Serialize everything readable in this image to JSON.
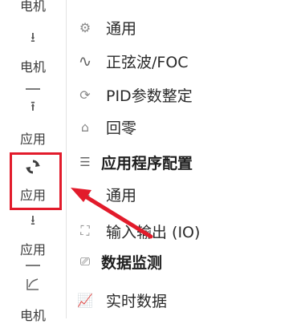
{
  "sidebar": {
    "items": [
      {
        "label": "电机",
        "icon": "download-arrow-icon"
      },
      {
        "label": "电机",
        "icon": "download-arrow-icon"
      },
      {
        "label": "应用",
        "icon": "upload-arrow-icon"
      },
      {
        "label": "应用",
        "icon": "refresh-icon"
      },
      {
        "label": "应用",
        "icon": "download-arrow-icon"
      },
      {
        "label": "电机",
        "icon": "motor-curve-icon"
      }
    ]
  },
  "panel": {
    "items": [
      {
        "label": "通用",
        "icon": "settings-icon"
      },
      {
        "label": "正弦波/FOC",
        "icon": "sine-wave-icon"
      },
      {
        "label": "PID参数整定",
        "icon": "tuning-icon"
      },
      {
        "label": "回零",
        "icon": "homing-icon"
      },
      {
        "label": "应用程序配置",
        "icon": "list-config-icon",
        "section": true
      },
      {
        "label": "通用",
        "icon": "settings-icon"
      },
      {
        "label": "输入输出 (IO)",
        "icon": "expand-icon"
      },
      {
        "label": "数据监测",
        "icon": "monitor-icon",
        "section": true
      },
      {
        "label": "实时数据",
        "icon": "realtime-chart-icon"
      }
    ]
  },
  "colors": {
    "highlight": "#e21b2b",
    "refresh_icon": "#3d3d3d"
  }
}
